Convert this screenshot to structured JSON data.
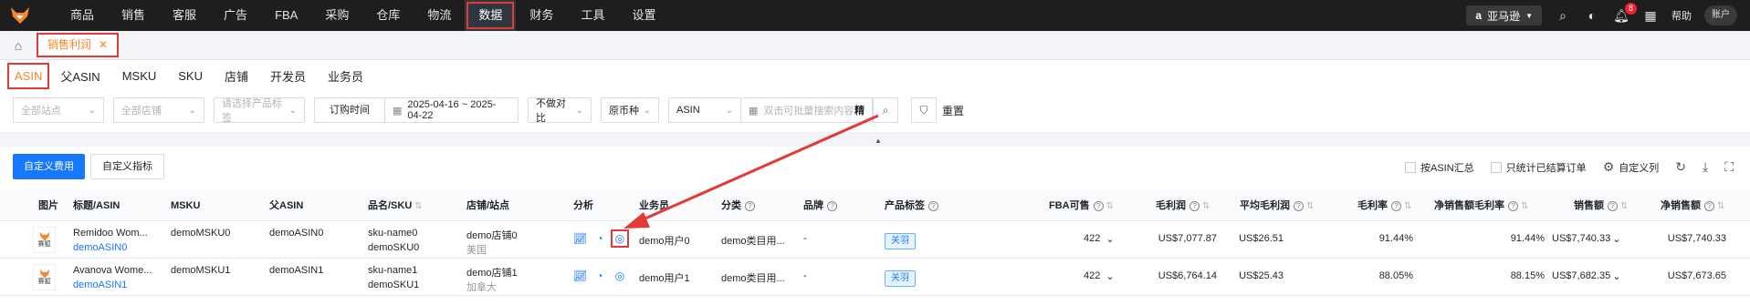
{
  "topnav": {
    "items": [
      "商品",
      "销售",
      "客服",
      "广告",
      "FBA",
      "采购",
      "仓库",
      "物流",
      "数据",
      "财务",
      "工具",
      "设置"
    ],
    "active_index": 8,
    "marketplace": "亚马逊",
    "notification_count": "8",
    "help": "帮助",
    "account": "账户"
  },
  "page_tabs": [
    {
      "label": "销售利润"
    }
  ],
  "subtabs": [
    "ASIN",
    "父ASIN",
    "MSKU",
    "SKU",
    "店铺",
    "开发员",
    "业务员"
  ],
  "filters": {
    "site_placeholder": "全部站点",
    "shop_placeholder": "全部店铺",
    "tag_placeholder": "请选择产品标签",
    "date_type": "订购时间",
    "date_range": "2025-04-16 ~ 2025-04-22",
    "compare": "不做对比",
    "currency": "原币种",
    "search_field": "ASIN",
    "search_placeholder": "双击可批量搜索内容",
    "precise": "精",
    "reset": "重置"
  },
  "actions": {
    "custom_fee": "自定义费用",
    "custom_metric": "自定义指标",
    "by_asin": "按ASIN汇总",
    "settled_only": "只统计已结算订单",
    "custom_columns": "自定义列"
  },
  "table": {
    "headers": {
      "image": "图片",
      "title_asin": "标题/ASIN",
      "msku": "MSKU",
      "parent_asin": "父ASIN",
      "name_sku": "品名/SKU",
      "shop_site": "店铺/站点",
      "analysis": "分析",
      "salesperson": "业务员",
      "category": "分类",
      "brand": "品牌",
      "product_tag": "产品标签",
      "fba_available": "FBA可售",
      "gross_profit": "毛利润",
      "avg_gross_profit": "平均毛利润",
      "gross_margin": "毛利率",
      "net_sales_margin": "净销售额毛利率",
      "sales": "销售额",
      "net_sales": "净销售额"
    },
    "rows": [
      {
        "thumb_text": "赛狐",
        "title": "Remidoo Wom...",
        "asin": "demoASIN0",
        "msku": "demoMSKU0",
        "parent_asin": "demoASIN0",
        "name": "sku-name0",
        "sku": "demoSKU0",
        "shop": "demo店铺0",
        "site": "美国",
        "salesperson": "demo用户0",
        "category": "demo类目用...",
        "brand": "-",
        "tag": "关羽",
        "fba": "422",
        "gross_profit": "US$7,077.87",
        "avg_gross_profit": "US$26.51",
        "gross_margin": "91.44%",
        "net_margin": "91.44%",
        "sales": "US$7,740.33",
        "net_sales": "US$7,740.33"
      },
      {
        "thumb_text": "赛狐",
        "title": "Avanova Wome...",
        "asin": "demoASIN1",
        "msku": "demoMSKU1",
        "parent_asin": "demoASIN1",
        "name": "sku-name1",
        "sku": "demoSKU1",
        "shop": "demo店铺1",
        "site": "加拿大",
        "salesperson": "demo用户1",
        "category": "demo类目用...",
        "brand": "-",
        "tag": "关羽",
        "fba": "422",
        "gross_profit": "US$6,764.14",
        "avg_gross_profit": "US$25.43",
        "gross_margin": "88.05%",
        "net_margin": "88.15%",
        "sales": "US$7,682.35",
        "net_sales": "US$7,673.65"
      }
    ]
  },
  "colors": {
    "accent": "#f5872b",
    "primary": "#1677ff",
    "highlight": "#e53935",
    "topbar": "#1e1e1e"
  }
}
